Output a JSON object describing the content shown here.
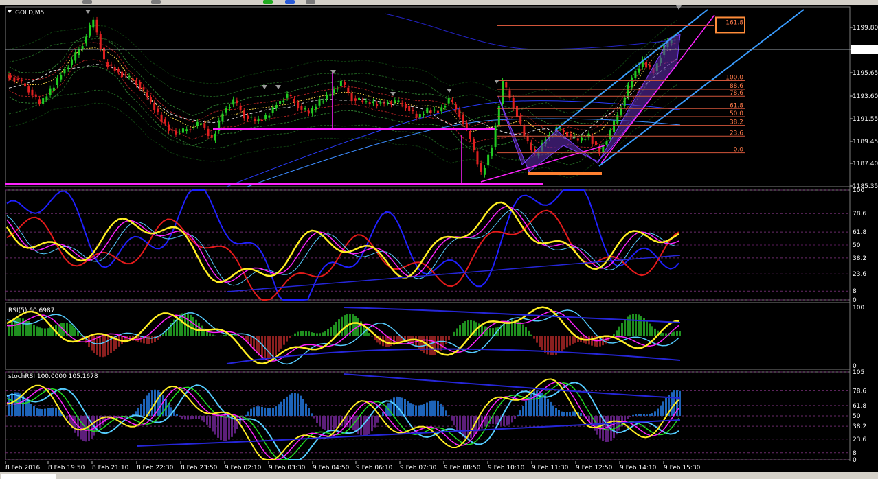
{
  "chart_data": {
    "type": "candlestick",
    "symbol_title": "GOLD,M5",
    "price_ticks": [
      "1199.80",
      "1197.81",
      "1195.65",
      "1193.60",
      "1191.55",
      "1189.45",
      "1187.40",
      "1185.35"
    ],
    "current_price": "1197.81",
    "time_labels": [
      "8 Feb 2016",
      "8 Feb 19:50",
      "8 Feb 21:10",
      "8 Feb 22:30",
      "8 Feb 23:50",
      "9 Feb 02:10",
      "9 Feb 03:30",
      "9 Feb 04:50",
      "9 Feb 06:10",
      "9 Feb 07:30",
      "9 Feb 08:50",
      "9 Feb 10:10",
      "9 Feb 11:30",
      "9 Feb 12:50",
      "9 Feb 14:10",
      "9 Feb 15:30"
    ],
    "fib_levels": [
      "161.8",
      "100.0",
      "88.6",
      "78.6",
      "61.8",
      "50.0",
      "38.2",
      "23.6",
      "0.0"
    ],
    "fib_prices": [
      1199.85,
      1194.75,
      1193.95,
      1193.3,
      1192.15,
      1191.4,
      1190.6,
      1189.6,
      1188.05
    ],
    "price_path": [
      1195.2,
      1194.8,
      1193.9,
      1192.6,
      1193.8,
      1195.4,
      1196.6,
      1198.2,
      1200.4,
      1196.5,
      1195.8,
      1195.1,
      1194.6,
      1193.2,
      1191.6,
      1190.2,
      1189.9,
      1190.4,
      1190.8,
      1189.2,
      1191.8,
      1192.9,
      1191.5,
      1191.0,
      1191.3,
      1192.6,
      1193.4,
      1192.4,
      1191.7,
      1192.8,
      1193.6,
      1194.6,
      1193.1,
      1192.8,
      1192.6,
      1192.7,
      1192.8,
      1192.4,
      1191.3,
      1192.0,
      1191.9,
      1193.0,
      1191.6,
      1189.3,
      1186.0,
      1188.6,
      1194.6,
      1192.4,
      1189.6,
      1187.8,
      1189.4,
      1190.3,
      1189.8,
      1189.2,
      1189.6,
      1188.1,
      1190.0,
      1192.4,
      1195.0,
      1196.5,
      1195.6,
      1197.9,
      1198.8
    ],
    "rsi_title": "RSI(5) 60.6987",
    "stoch_title": "stochRSI 100.0000 105.1678",
    "osc_ticks_top": [
      "100",
      "78.6",
      "61.8",
      "50",
      "38.2",
      "23.6",
      "8",
      "0"
    ],
    "rsi_ticks": [
      "100",
      "0"
    ],
    "stoch_ticks": [
      "105",
      "78.6",
      "61.8",
      "50",
      "38.2",
      "23.6",
      "8",
      "0"
    ]
  }
}
